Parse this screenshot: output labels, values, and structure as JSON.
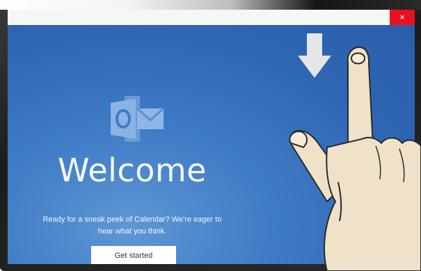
{
  "window": {
    "close_label": "×"
  },
  "welcome": {
    "title": "Welcome",
    "description": "Ready for a sneak peek of Calendar? We're eager to hear what you think.",
    "get_started_label": "Get started"
  },
  "icons": {
    "app_logo": "outlook-icon",
    "gesture_arrow": "arrow-down-icon",
    "hand": "hand-swipe-icon",
    "close": "close-icon"
  },
  "colors": {
    "background_blue": "#3f7cc6",
    "close_red": "#e81123",
    "logo_blue": "#7fa9dd"
  }
}
